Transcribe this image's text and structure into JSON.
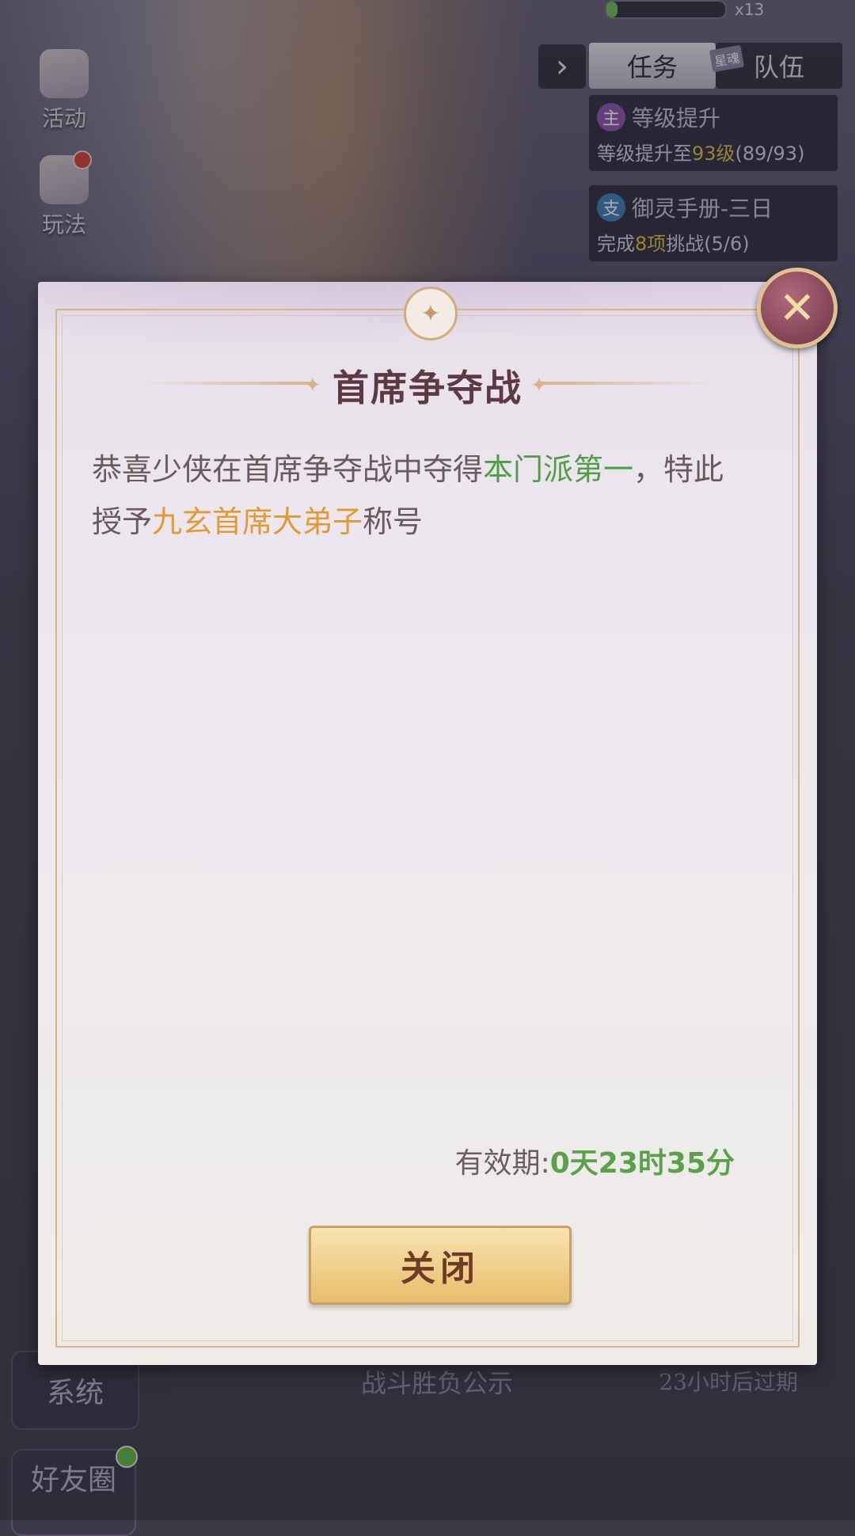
{
  "background": {
    "side_menu": {
      "activity_label": "活动",
      "gameplay_label": "玩法",
      "system_label": "系统",
      "partial_bottom_label": "好友圈"
    },
    "task_panel": {
      "toggle_icon": "chevron-right-icon",
      "tabs": [
        "任务",
        "队伍"
      ],
      "tab_badge": "星魂",
      "quests": [
        {
          "tag": "主",
          "title": "等级提升",
          "desc_prefix": "等级提升至",
          "desc_highlight": "93级",
          "progress": "(89/93)"
        },
        {
          "tag": "支",
          "title": "御灵手册-三日",
          "desc_prefix": "完成",
          "desc_highlight": "8项",
          "desc_suffix": "挑战",
          "progress": "(5/6)"
        }
      ]
    },
    "top_counter": "x13",
    "bg_list_row": {
      "label": "战斗胜负公示",
      "expiry": "23小时后过期"
    }
  },
  "dialog": {
    "title": "首席争夺战",
    "message_part1": "恭喜少侠在首席争夺战中夺得",
    "message_highlight1": "本门派第一",
    "message_part2": "，特此授予",
    "message_highlight2": "九玄首席大弟子",
    "message_part3": "称号",
    "validity_label": "有效期:",
    "validity_value": "0天23时35分",
    "close_button_label": "关闭",
    "close_icon": "close-x-icon"
  },
  "colors": {
    "highlight_green": "#4f9e45",
    "highlight_orange": "#e39a33",
    "title": "#5c3a44",
    "button_gold": "#efcd86"
  }
}
